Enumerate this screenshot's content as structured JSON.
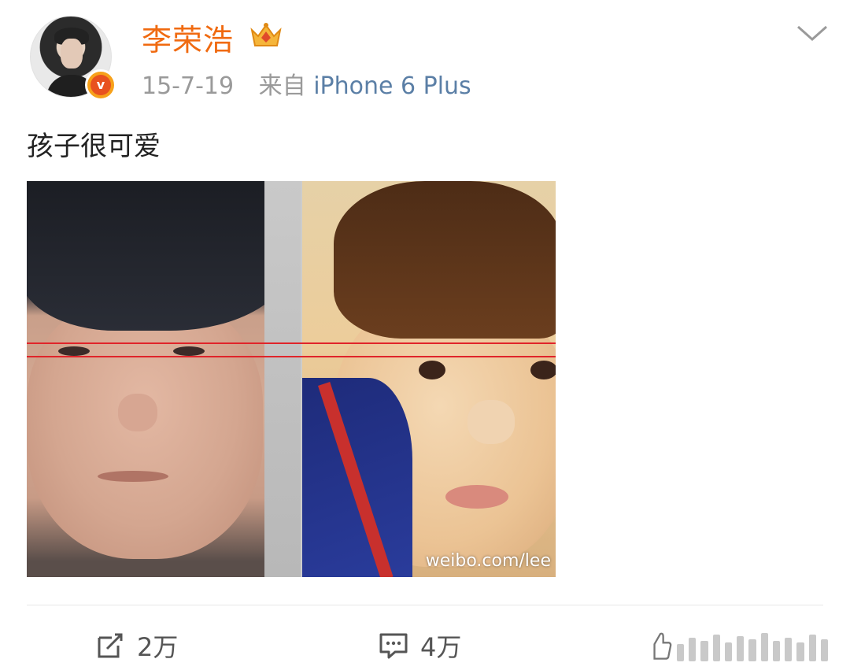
{
  "post": {
    "author": {
      "name": "李荣浩",
      "avatar_icon": "user-avatar",
      "verified_icon": "verified-v-icon",
      "vip_icon": "crown-vip-icon",
      "verified_glyph": "v"
    },
    "date": "15-7-19",
    "source_prefix": "来自",
    "source_device": "iPhone 6 Plus",
    "menu_icon": "chevron-down-icon",
    "text": "孩子很可爱",
    "image": {
      "watermark": "weibo.com/lee",
      "line_color": "#e0242a"
    }
  },
  "actions": {
    "repost": {
      "icon": "repost-icon",
      "count": "2万"
    },
    "comment": {
      "icon": "comment-icon",
      "count": "4万"
    },
    "like": {
      "icon": "like-icon"
    }
  },
  "colors": {
    "username": "#f06a10",
    "source": "#5b7fa6",
    "meta": "#9a9a9a"
  }
}
